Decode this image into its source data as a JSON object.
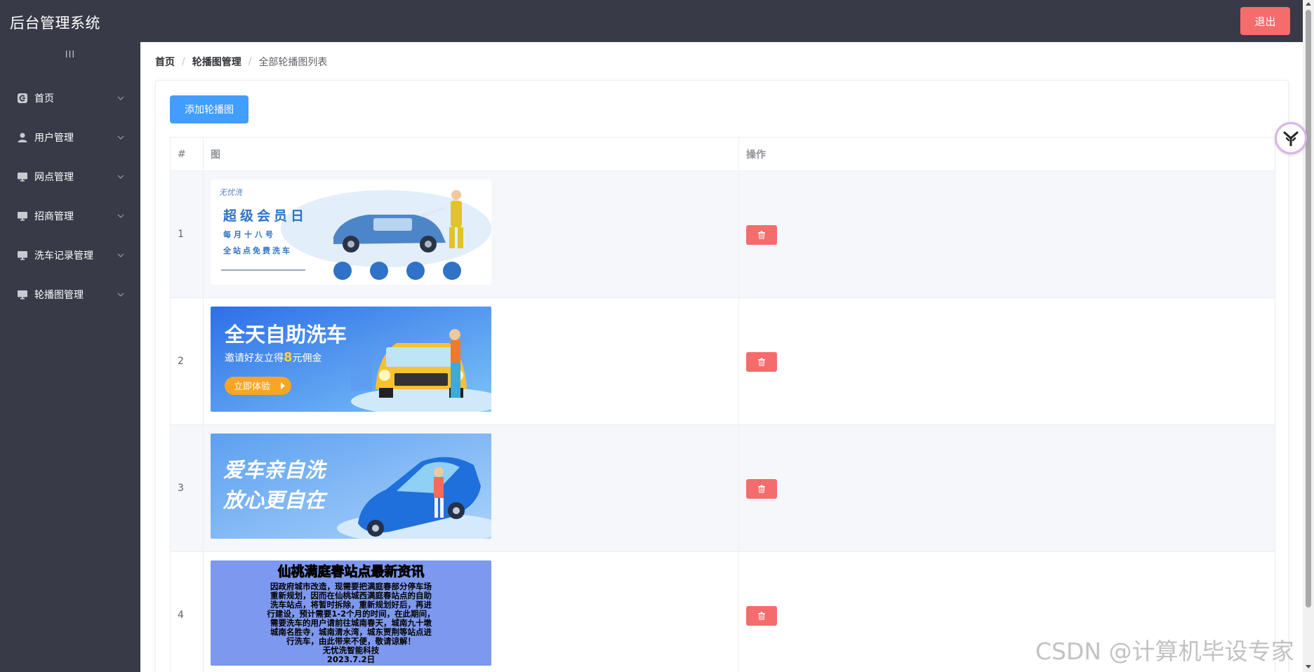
{
  "header": {
    "app_title": "后台管理系统",
    "logout_label": "退出"
  },
  "sidebar": {
    "toggle_glyph": "III",
    "items": [
      {
        "label": "首页",
        "icon": "home-icon"
      },
      {
        "label": "用户管理",
        "icon": "user-icon"
      },
      {
        "label": "网点管理",
        "icon": "monitor-icon"
      },
      {
        "label": "招商管理",
        "icon": "monitor-icon"
      },
      {
        "label": "洗车记录管理",
        "icon": "monitor-icon"
      },
      {
        "label": "轮播图管理",
        "icon": "monitor-icon"
      }
    ]
  },
  "breadcrumb": {
    "home": "首页",
    "section": "轮播图管理",
    "current": "全部轮播图列表",
    "separator": "/"
  },
  "toolbar": {
    "add_label": "添加轮播图"
  },
  "table": {
    "headers": {
      "index": "#",
      "image": "图",
      "actions": "操作"
    },
    "rows": [
      {
        "index": "1",
        "banner": {
          "brand": "无忧洗",
          "line1": "超级会员日",
          "line2": "每月十八号",
          "line3": "全站点免费洗车"
        }
      },
      {
        "index": "2",
        "banner": {
          "title": "全天自助洗车",
          "subtitle_pre": "邀请好友立得",
          "subtitle_num": "8",
          "subtitle_post": "元佣金",
          "cta": "立即体验"
        }
      },
      {
        "index": "3",
        "banner": {
          "line1": "爱车亲自洗",
          "line2": "放心更自在"
        }
      },
      {
        "index": "4",
        "banner": {
          "title": "仙桃满庭春站点最新资讯",
          "body": [
            "因政府城市改造，现需要把满庭春部分停车场",
            "重新规划，因而在仙桃城西满庭春站点的自助",
            "洗车站点，将暂时拆除，重新规划好后，再进",
            "行建设，预计需要1-2个月的时间，在此期间，",
            "需要洗车的用户请前往城南春天，城南九十墩",
            "城南名胜寺，城南清水湾，城东贾荆等站点进",
            "行洗车，由此带来不便，敬请谅解！",
            "无忧洗智能科技",
            "2023.7.2日"
          ]
        }
      }
    ]
  },
  "watermark": "CSDN @计算机毕设专家",
  "colors": {
    "sidebar_bg": "#383a47",
    "primary": "#409eff",
    "danger": "#f56c6c"
  }
}
